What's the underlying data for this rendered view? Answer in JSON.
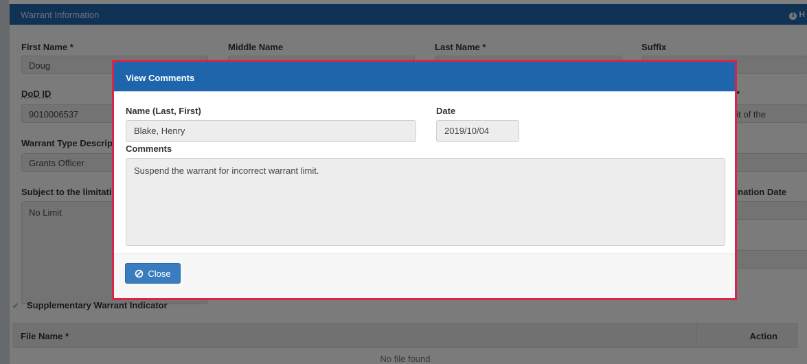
{
  "panel": {
    "title": "Warrant Information",
    "help_label": "H"
  },
  "form": {
    "first_name_label": "First Name *",
    "first_name_value": "Doug",
    "middle_name_label": "Middle Name",
    "last_name_label": "Last Name *",
    "suffix_label": "Suffix",
    "dod_id_label": "DoD ID",
    "dod_id_value": "9010006537",
    "right_label_fragment": "*",
    "right_value_fragment": "it of the",
    "warrant_type_label": "Warrant Type Descrip",
    "warrant_type_value": "Grants Officer",
    "subject_label": "Subject to the limitati",
    "subject_value": "No Limit",
    "termination_label": "rmination Date",
    "supplementary_label": "Supplementary Warrant Indicator"
  },
  "files": {
    "col_file_name": "File Name *",
    "col_action": "Action",
    "empty_text": "No file found"
  },
  "modal": {
    "title": "View Comments",
    "name_label": "Name (Last, First)",
    "name_value": "Blake, Henry",
    "date_label": "Date",
    "date_value": "2019/10/04",
    "comments_label": "Comments",
    "comments_value": "Suspend the warrant for incorrect warrant limit.",
    "close_label": "Close"
  },
  "colors": {
    "header_blue": "#1e65ab",
    "button_blue": "#3a7dbf",
    "highlight_red": "#d8264a"
  }
}
